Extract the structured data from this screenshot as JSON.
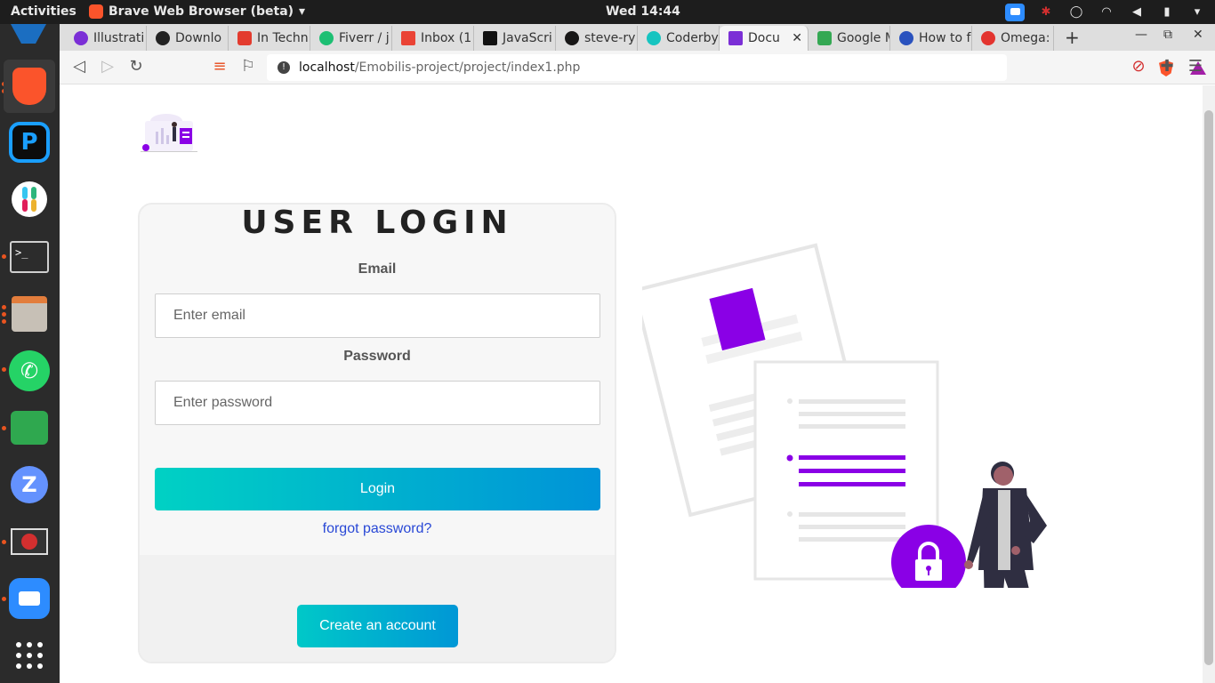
{
  "system": {
    "activities": "Activities",
    "app_name": "Brave Web Browser (beta)",
    "clock": "Wed 14:44"
  },
  "tabs": [
    {
      "label": "Illustrati",
      "color": "#7b2fd6"
    },
    {
      "label": "Downlo",
      "color": "#222222"
    },
    {
      "label": "In Techn",
      "color": "#e33b2e"
    },
    {
      "label": "Fiverr / j",
      "color": "#1dbf73"
    },
    {
      "label": "Inbox (1",
      "color": "#ea4335"
    },
    {
      "label": "JavaScri",
      "color": "#111111"
    },
    {
      "label": "steve-ry",
      "color": "#181717"
    },
    {
      "label": "Coderby",
      "color": "#16c4c0"
    },
    {
      "label": "Docu",
      "color": "#7b2fd6",
      "active": true
    },
    {
      "label": "Google M",
      "color": "#34a853"
    },
    {
      "label": "How to f",
      "color": "#2a52be"
    },
    {
      "label": "Omega:",
      "color": "#e3342f"
    }
  ],
  "address": {
    "host": "localhost",
    "path": "/Emobilis-project/project/index1.php"
  },
  "login": {
    "title": "USER LOGIN",
    "email_label": "Email",
    "email_placeholder": "Enter email",
    "password_label": "Password",
    "password_placeholder": "Enter password",
    "login_button": "Login",
    "forgot_link": "forgot password?",
    "create_button": "Create an account"
  },
  "colors": {
    "accent_gradient_start": "#00d1c4",
    "accent_gradient_end": "#0093d8",
    "illustration_purple": "#8a00e6",
    "link_blue": "#2948d6"
  },
  "icons": {
    "lock": "lock-icon",
    "shields": "brave-shields-icon",
    "rewards": "brave-rewards-icon"
  }
}
